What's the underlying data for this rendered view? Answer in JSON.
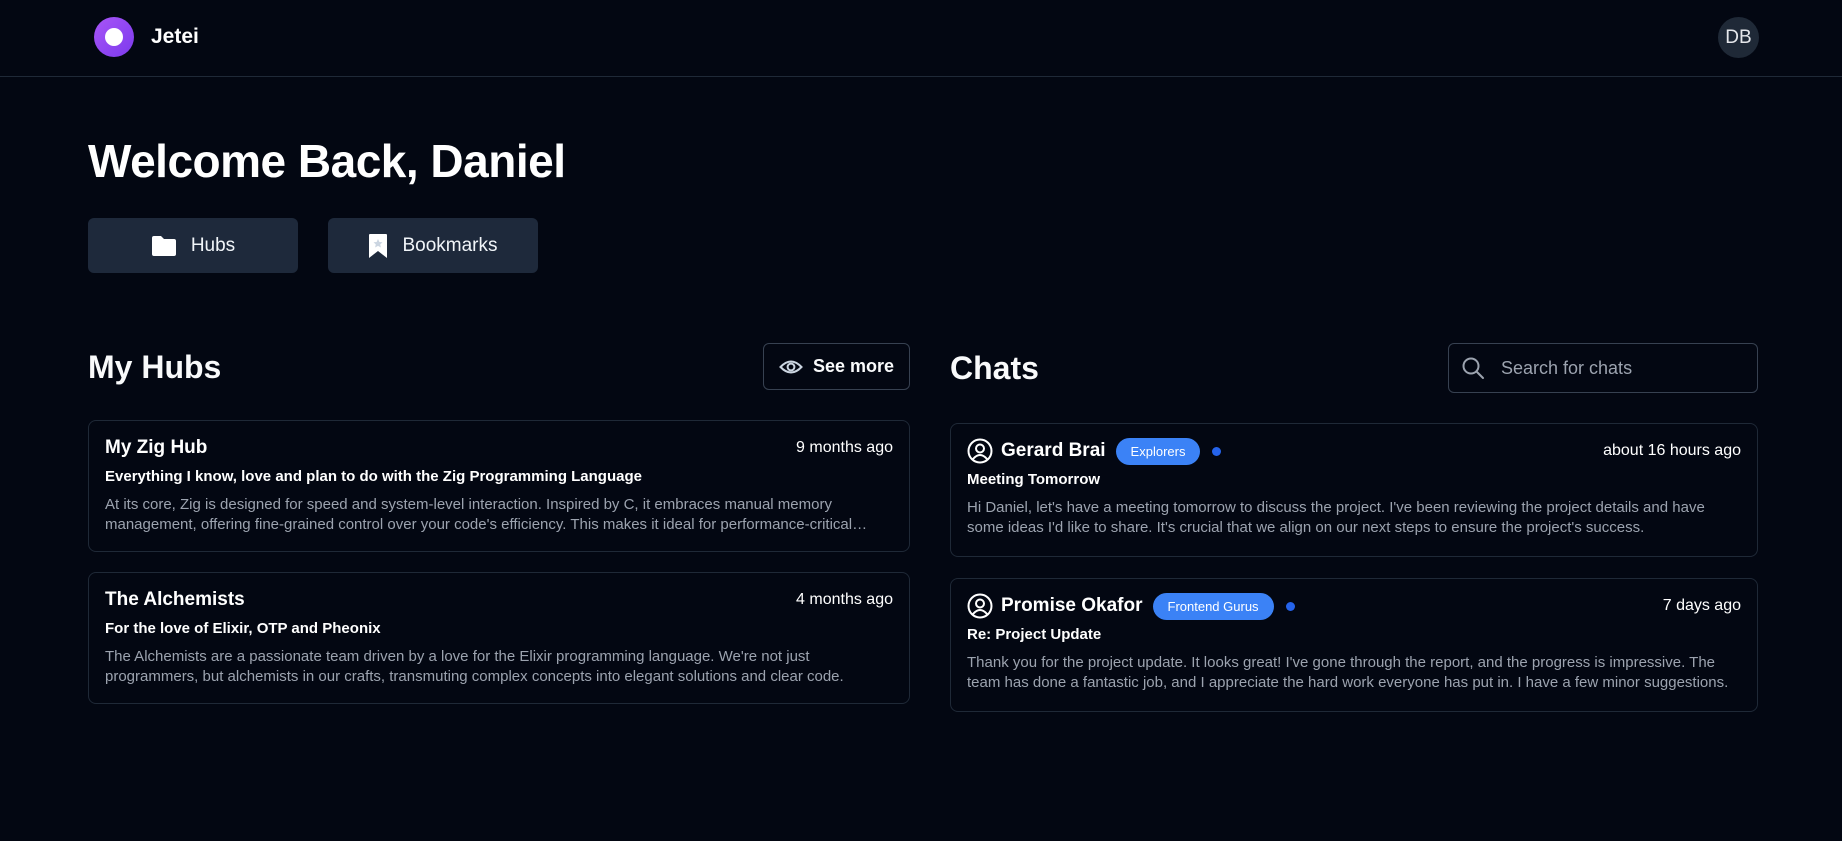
{
  "header": {
    "brand": "Jetei",
    "avatar_initials": "DB"
  },
  "welcome": "Welcome Back, Daniel",
  "quick_buttons": {
    "hubs": "Hubs",
    "bookmarks": "Bookmarks"
  },
  "my_hubs": {
    "title": "My Hubs",
    "see_more": "See more",
    "items": [
      {
        "title": "My Zig Hub",
        "time": "9 months ago",
        "subtitle": "Everything I know, love and plan to do with the Zig Programming Language",
        "body": "At its core, Zig is designed for speed and system-level interaction. Inspired by C, it embraces manual memory management, offering fine-grained control over your code's efficiency. This makes it ideal for performance-critical applications."
      },
      {
        "title": "The Alchemists",
        "time": "4 months ago",
        "subtitle": "For the love of Elixir, OTP and Pheonix",
        "body": "The Alchemists are a passionate team driven by a love for the Elixir programming language. We're not just programmers, but alchemists in our crafts, transmuting complex concepts into elegant solutions and clear code."
      }
    ]
  },
  "chats": {
    "title": "Chats",
    "search_placeholder": "Search for chats",
    "items": [
      {
        "name": "Gerard Brai",
        "tag": "Explorers",
        "time": "about 16 hours ago",
        "subject": "Meeting Tomorrow",
        "body": "Hi Daniel, let's have a meeting tomorrow to discuss the project. I've been reviewing the project details and have some ideas I'd like to share. It's crucial that we align on our next steps to ensure the project's success."
      },
      {
        "name": "Promise Okafor",
        "tag": "Frontend Gurus",
        "time": "7 days ago",
        "subject": "Re: Project Update",
        "body": "Thank you for the project update. It looks great! I've gone through the report, and the progress is impressive. The team has done a fantastic job, and I appreciate the hard work everyone has put in. I have a few minor suggestions."
      }
    ]
  },
  "colors": {
    "background": "#030712",
    "accent": "#3b82f6",
    "logo": "#8b5cf6",
    "button_bg": "#1e293b"
  }
}
